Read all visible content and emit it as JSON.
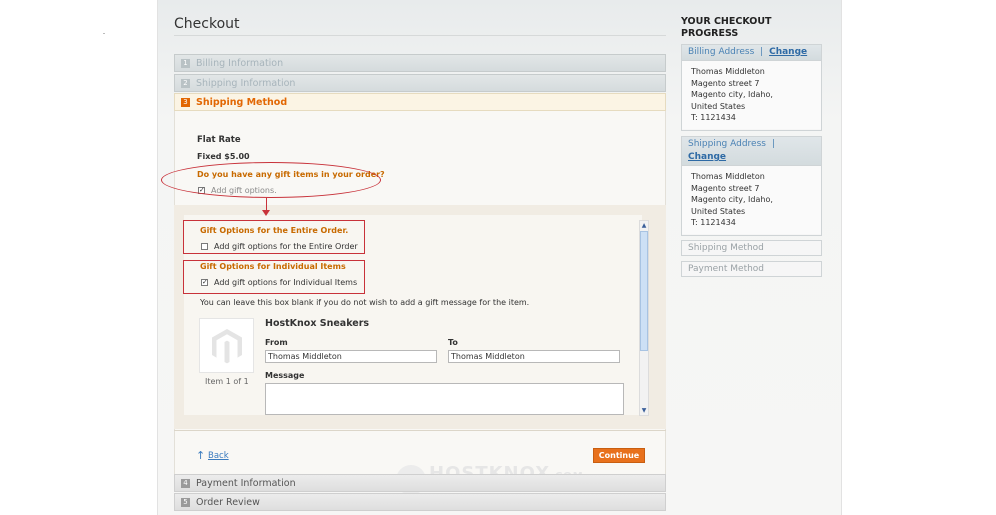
{
  "page": {
    "title": "Checkout"
  },
  "steps": [
    {
      "num": "1",
      "label": "Billing Information"
    },
    {
      "num": "2",
      "label": "Shipping Information"
    },
    {
      "num": "3",
      "label": "Shipping Method"
    },
    {
      "num": "4",
      "label": "Payment Information"
    },
    {
      "num": "5",
      "label": "Order Review"
    }
  ],
  "shipping_method": {
    "carrier": "Flat Rate",
    "rate": "Fixed $5.00",
    "gift_question": "Do you have any gift items in your order?",
    "add_gift_options_label": "Add gift options.",
    "add_gift_options_checked": true
  },
  "gift_options": {
    "entire_order_title": "Gift Options for the Entire Order.",
    "entire_order_label": "Add gift options for the Entire Order",
    "entire_order_checked": false,
    "individual_title": "Gift Options for Individual Items",
    "individual_label": "Add gift options for Individual Items",
    "individual_checked": true,
    "hint": "You can leave this box blank if you do not wish to add a gift message for the item.",
    "item": {
      "name": "HostKnox Sneakers",
      "from_label": "From",
      "from_value": "Thomas  Middleton",
      "to_label": "To",
      "to_value": "Thomas  Middleton",
      "message_label": "Message",
      "counter": "Item 1 of 1"
    }
  },
  "actions": {
    "back": "Back",
    "continue": "Continue"
  },
  "watermark": {
    "text": "HOSTKNOX",
    "suffix": ".COM"
  },
  "sidebar": {
    "title_line1": "YOUR CHECKOUT",
    "title_line2": "PROGRESS",
    "separator": "|",
    "billing": {
      "heading": "Billing Address",
      "change": "Change",
      "lines": [
        "Thomas Middleton",
        "Magento street 7",
        "Magento city, Idaho,",
        "United States",
        "T: 1121434"
      ]
    },
    "shipping": {
      "heading": "Shipping Address",
      "change": "Change",
      "lines": [
        "Thomas Middleton",
        "Magento street 7",
        "Magento city, Idaho,",
        "United States",
        "T: 1121434"
      ]
    },
    "shipping_method": "Shipping Method",
    "payment_method": "Payment Method"
  },
  "colors": {
    "accent": "#e26703",
    "link": "#3a7bbf",
    "annotation": "#c8323a"
  }
}
